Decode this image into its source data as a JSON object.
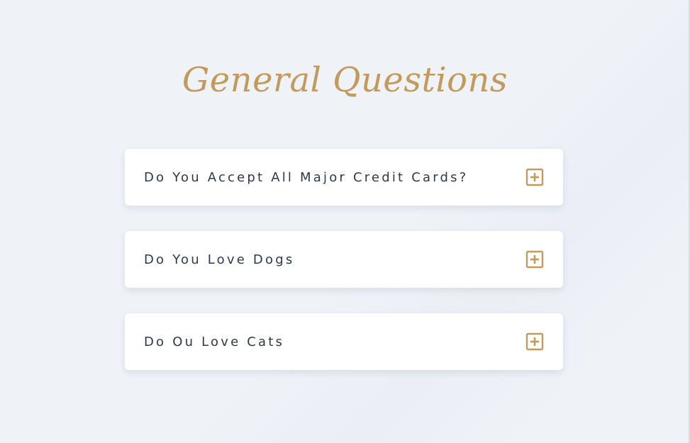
{
  "page": {
    "title": "General Questions",
    "accent_color": "#c29a5b",
    "background_color": "#eff2f7"
  },
  "faq": {
    "items": [
      {
        "question": "Do You Accept All Major Credit Cards?",
        "icon": "plus-square-icon",
        "expanded": false
      },
      {
        "question": "Do You Love Dogs",
        "icon": "plus-square-icon",
        "expanded": false
      },
      {
        "question": "Do Ou Love Cats",
        "icon": "plus-square-icon",
        "expanded": false
      }
    ]
  }
}
